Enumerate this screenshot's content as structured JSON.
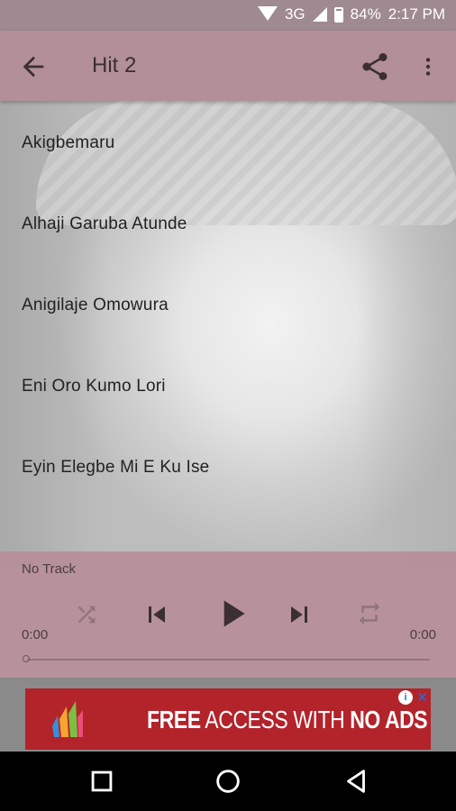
{
  "status_bar": {
    "network": "3G",
    "battery": "84%",
    "time": "2:17 PM"
  },
  "app_bar": {
    "title": "Hit 2",
    "icons": [
      "back-arrow-icon",
      "share-icon",
      "more-vert-icon"
    ]
  },
  "songs": [
    "Akigbemaru",
    "Alhaji Garuba Atunde",
    "Anigilaje Omowura",
    "Eni Oro Kumo Lori",
    "Eyin Elegbe Mi E Ku Ise"
  ],
  "player": {
    "track": "No Track",
    "elapsed": "0:00",
    "duration": "0:00",
    "progress": 0,
    "controls": [
      "shuffle-icon",
      "previous-icon",
      "play-icon",
      "next-icon",
      "repeat-icon"
    ]
  },
  "ad": {
    "text_bold_1": "FREE",
    "text_thin": " ACCESS WITH ",
    "text_bold_2": "NO ADS",
    "info": "i",
    "close": "✕"
  },
  "colors": {
    "status_bar": "#9e8a90",
    "app_bar": "#b38f98",
    "player": "#b68c96",
    "ad_background": "#b3232a"
  }
}
